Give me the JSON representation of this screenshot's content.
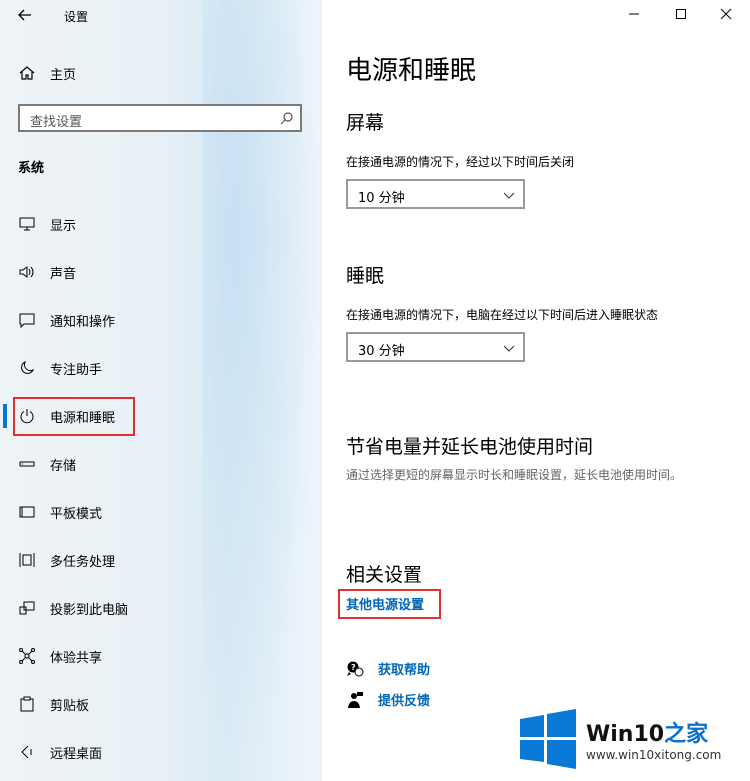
{
  "window": {
    "title": "设置"
  },
  "sidebar": {
    "home_label": "主页",
    "search_placeholder": "查找设置",
    "section_label": "系统",
    "items": [
      {
        "label": "显示",
        "icon": "monitor-icon"
      },
      {
        "label": "声音",
        "icon": "speaker-icon"
      },
      {
        "label": "通知和操作",
        "icon": "message-icon"
      },
      {
        "label": "专注助手",
        "icon": "moon-icon"
      },
      {
        "label": "电源和睡眠",
        "icon": "power-icon",
        "active": true
      },
      {
        "label": "存储",
        "icon": "storage-icon"
      },
      {
        "label": "平板模式",
        "icon": "tablet-icon"
      },
      {
        "label": "多任务处理",
        "icon": "multitask-icon"
      },
      {
        "label": "投影到此电脑",
        "icon": "project-icon"
      },
      {
        "label": "体验共享",
        "icon": "share-icon"
      },
      {
        "label": "剪贴板",
        "icon": "clipboard-icon"
      },
      {
        "label": "远程桌面",
        "icon": "remote-icon"
      }
    ]
  },
  "main": {
    "title": "电源和睡眠",
    "screen": {
      "heading": "屏幕",
      "desc": "在接通电源的情况下，经过以下时间后关闭",
      "value": "10 分钟"
    },
    "sleep": {
      "heading": "睡眠",
      "desc": "在接通电源的情况下，电脑在经过以下时间后进入睡眠状态",
      "value": "30 分钟"
    },
    "battery": {
      "heading": "节省电量并延长电池使用时间",
      "desc": "通过选择更短的屏幕显示时长和睡眠设置，延长电池使用时间。"
    },
    "related": {
      "heading": "相关设置",
      "link": "其他电源设置"
    },
    "help": {
      "get_help": "获取帮助",
      "feedback": "提供反馈"
    }
  },
  "watermark": {
    "brand_prefix": "Win10",
    "brand_suffix": "之家",
    "url": "www.win10xitong.com"
  },
  "colors": {
    "accent": "#0078d7",
    "link": "#0067b8",
    "highlight": "#e03030"
  }
}
